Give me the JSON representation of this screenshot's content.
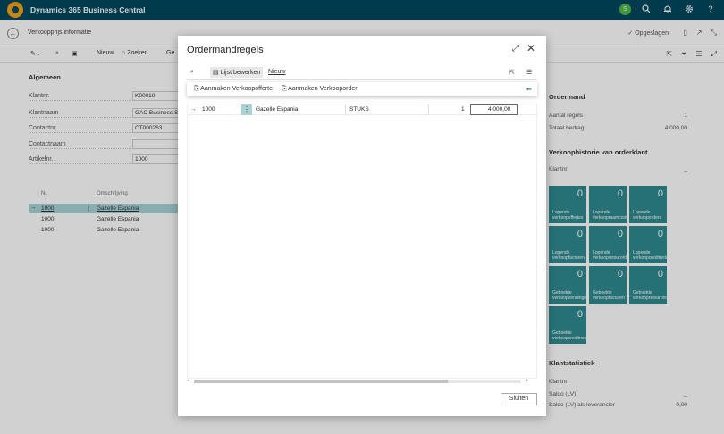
{
  "app": {
    "title": "Dynamics 365 Business Central",
    "avatar_initial": "S"
  },
  "top_icons": [
    "search-icon",
    "bell-icon",
    "gear-icon",
    "help-icon"
  ],
  "page": {
    "title": "Verkoopprijs informatie",
    "saved_label": "Opgeslagen"
  },
  "actionbar": {
    "new_label": "Nieuw",
    "find_label": "Zoeken",
    "ge_label": "Ge"
  },
  "general": {
    "section": "Algemeen",
    "fields": [
      {
        "label": "Klantnr.",
        "value": "K00010"
      },
      {
        "label": "Klantnaam",
        "value": "GAC Business Sc"
      },
      {
        "label": "Contactnr.",
        "value": "CT000263"
      },
      {
        "label": "Contactnaam",
        "value": ""
      },
      {
        "label": "Artikelnr.",
        "value": "1000"
      }
    ]
  },
  "lines": {
    "col_nr": "Nr.",
    "col_desc": "Omschrijving",
    "rows": [
      {
        "nr": "1000",
        "desc": "Gazelle Espania"
      },
      {
        "nr": "1000",
        "desc": "Gazelle Espania"
      },
      {
        "nr": "1000",
        "desc": "Gazelle Espania"
      }
    ]
  },
  "factbox": {
    "ordermand_title": "Ordermand",
    "aantal_label": "Aantal regels",
    "aantal_value": "1",
    "totaal_label": "Totaal bedrag",
    "totaal_value": "4.000,00",
    "hist_title": "Verkoophistorie van orderklant",
    "klantnr_label": "Klantnr.",
    "klantnr_value": "_",
    "tiles": [
      {
        "num": "0",
        "label": "Lopende verkoopoffertes"
      },
      {
        "num": "0",
        "label": "Lopende verkoopraamcontracten"
      },
      {
        "num": "0",
        "label": "Lopende verkooporders"
      },
      {
        "num": "0",
        "label": "Lopende verkoopfacturen"
      },
      {
        "num": "0",
        "label": "Lopende verkoopretourorders"
      },
      {
        "num": "0",
        "label": "Lopende verkoopcreditnota's"
      },
      {
        "num": "0",
        "label": "Geboekte verkoopzendingen"
      },
      {
        "num": "0",
        "label": "Geboekte verkoopfacturen"
      },
      {
        "num": "0",
        "label": "Geboekte verkoopretourontvangsten"
      },
      {
        "num": "0",
        "label": "Geboekte verkoopcreditnota's"
      }
    ],
    "stats_title": "Klantstatistiek",
    "stats": [
      {
        "label": "Klantnr.",
        "value": ""
      },
      {
        "label": "Saldo (LV)",
        "value": "_"
      },
      {
        "label": "Saldo (LV) als leverancier",
        "value": "0,00"
      }
    ]
  },
  "dialog": {
    "title": "Ordermandregels",
    "edit_list": "Lijst bewerken",
    "new": "Nieuw",
    "create_quote": "Aanmaken Verkoopofferte",
    "create_order": "Aanmaken Verkooporder",
    "row": {
      "nr": "1000",
      "desc": "Gazelle Espania",
      "unit": "STUKS",
      "qty": "1",
      "amount": "4.000,00"
    },
    "close_label": "Sluiten"
  }
}
